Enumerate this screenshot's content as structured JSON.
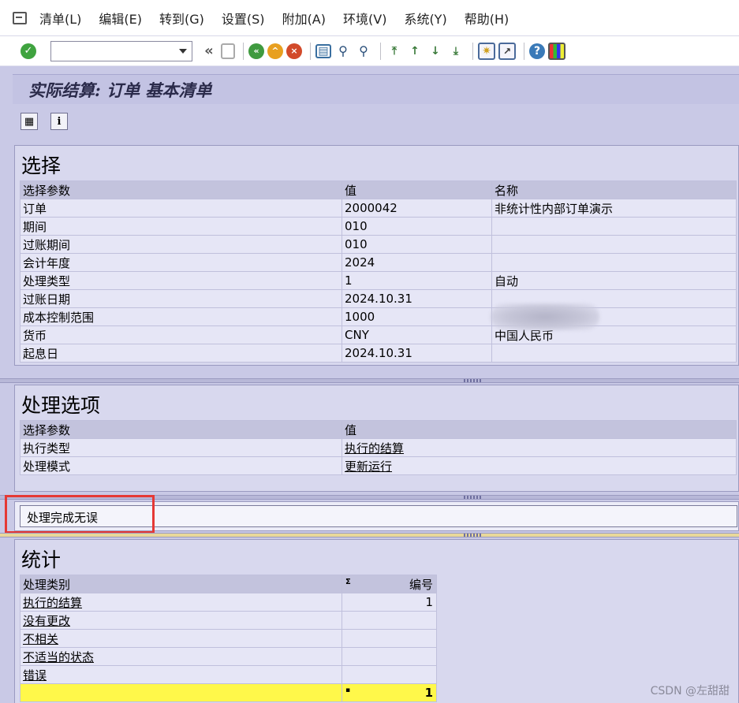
{
  "menu": [
    "清单(L)",
    "编辑(E)",
    "转到(G)",
    "设置(S)",
    "附加(A)",
    "环境(V)",
    "系统(Y)",
    "帮助(H)"
  ],
  "toolbar": {
    "command_value": "",
    "back_glyph": "«"
  },
  "page": {
    "title": "实际结算: 订单 基本清单"
  },
  "selection": {
    "title": "选择",
    "headers": [
      "选择参数",
      "值",
      "名称"
    ],
    "rows": [
      [
        "订单",
        "2000042",
        "非统计性内部订单演示"
      ],
      [
        "期间",
        "010",
        ""
      ],
      [
        "过账期间",
        "010",
        ""
      ],
      [
        "会计年度",
        "2024",
        ""
      ],
      [
        "处理类型",
        "1",
        "自动"
      ],
      [
        "过账日期",
        "2024.10.31",
        ""
      ],
      [
        "成本控制范围",
        "1000",
        ""
      ],
      [
        "货币",
        "CNY",
        "中国人民币"
      ],
      [
        "起息日",
        "2024.10.31",
        ""
      ]
    ]
  },
  "processing": {
    "title": "处理选项",
    "headers": [
      "选择参数",
      "值"
    ],
    "rows": [
      [
        "执行类型",
        "执行的结算"
      ],
      [
        "处理模式",
        "更新运行"
      ]
    ]
  },
  "message": {
    "text": "处理完成无误"
  },
  "stats": {
    "title": "统计",
    "headers": [
      "处理类别",
      "编号"
    ],
    "sigma": "Σ",
    "rows": [
      [
        "执行的结算",
        "1"
      ],
      [
        "没有更改",
        ""
      ],
      [
        "不相关",
        ""
      ],
      [
        "不适当的状态",
        ""
      ],
      [
        "错误",
        ""
      ]
    ],
    "total_marker": "▪",
    "total": "1"
  },
  "watermark": "CSDN @左甜甜",
  "colors": {
    "highlight": "#e53935",
    "total_row": "#fff84a"
  },
  "icons": [
    "enter-icon",
    "back-icon",
    "exit-icon",
    "cancel-icon",
    "print-icon",
    "find-icon",
    "find-next-icon",
    "first-page-icon",
    "prev-page-icon",
    "next-page-icon",
    "last-page-icon",
    "new-session-icon",
    "shortcut-icon",
    "help-icon",
    "layout-icon"
  ]
}
